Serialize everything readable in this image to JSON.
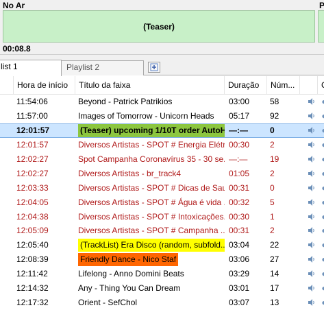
{
  "on_air": {
    "label": "No Ar",
    "right_label": "P",
    "content": "(Teaser)",
    "elapsed": "00:08.8"
  },
  "tabs": [
    {
      "label": "list 1",
      "active": true
    },
    {
      "label": "Playlist 2",
      "active": false
    }
  ],
  "add_tab_icon": "add-tab-icon",
  "columns": [
    "Hora de início",
    "Título da faixa",
    "Duração",
    "Núm...",
    "",
    "C"
  ],
  "colors": {
    "onair_bg": "#c8f0c8",
    "selected_bg": "#cce5ff",
    "spot_red": "#b01a1a",
    "highlight_green": "#8cc63f",
    "highlight_yellow": "#ffff00",
    "highlight_orange": "#ff6600"
  },
  "rows": [
    {
      "time": "11:54:06",
      "title": "Beyond - Patrick Patrikios",
      "duration": "03:00",
      "num": "58"
    },
    {
      "time": "11:57:00",
      "title": "Images of Tomorrow - Unicorn Heads",
      "duration": "05:17",
      "num": "92"
    },
    {
      "time": "12:01:57",
      "title": "(Teaser) upcoming 1/10T order AutoH...",
      "duration": "—:—",
      "num": "0"
    },
    {
      "time": "12:01:57",
      "title": "Diversos Artistas - SPOT # Energia Elétr...",
      "duration": "00:30",
      "num": "2"
    },
    {
      "time": "12:02:27",
      "title": "Spot Campanha Coronavírus 35 - 30 se...",
      "duration": "—:—",
      "num": "19"
    },
    {
      "time": "12:02:27",
      "title": "Diversos Artistas - br_track4",
      "duration": "01:05",
      "num": "2"
    },
    {
      "time": "12:03:33",
      "title": "Diversos Artistas - SPOT # Dicas de Sau...",
      "duration": "00:31",
      "num": "0"
    },
    {
      "time": "12:04:05",
      "title": "Diversos Artistas - SPOT # Água é vida ...",
      "duration": "00:32",
      "num": "5"
    },
    {
      "time": "12:04:38",
      "title": "Diversos Artistas - SPOT # Intoxicações...",
      "duration": "00:30",
      "num": "1"
    },
    {
      "time": "12:05:09",
      "title": "Diversos Artistas - SPOT # Campanha ...",
      "duration": "00:31",
      "num": "2"
    },
    {
      "time": "12:05:40",
      "title": "(TrackList) Era Disco (random, subfold...",
      "duration": "03:04",
      "num": "22"
    },
    {
      "time": "12:08:39",
      "title": "Friendly Dance - Nico Staf",
      "duration": "03:06",
      "num": "27"
    },
    {
      "time": "12:11:42",
      "title": "Lifelong - Anno Domini Beats",
      "duration": "03:29",
      "num": "14"
    },
    {
      "time": "12:14:32",
      "title": "Any - Thing You Can Dream",
      "duration": "03:01",
      "num": "17"
    },
    {
      "time": "12:17:32",
      "title": "Orient - SefChol",
      "duration": "03:07",
      "num": "13"
    }
  ]
}
